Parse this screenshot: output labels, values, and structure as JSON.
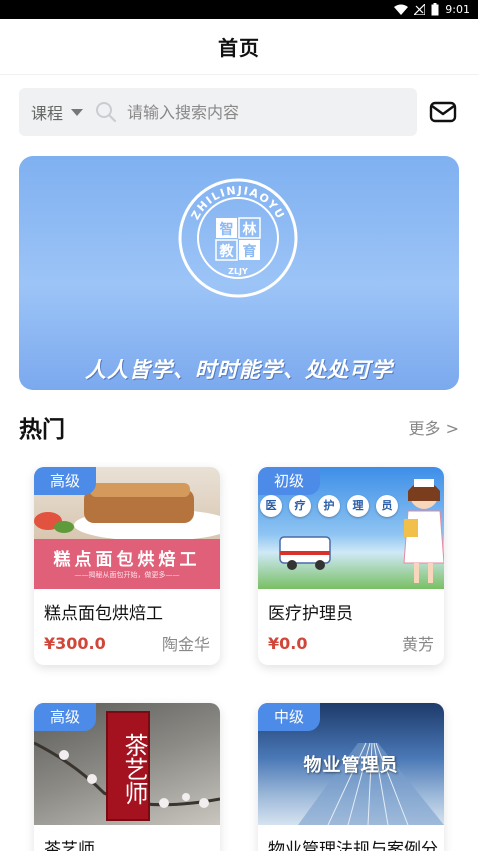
{
  "status_bar": {
    "time": "9:01"
  },
  "header": {
    "title": "首页"
  },
  "search": {
    "category": "课程",
    "placeholder": "请输入搜索内容",
    "value": ""
  },
  "banner": {
    "logo_text": "ZHILINJIAOYU",
    "logo_chars": [
      "智",
      "林",
      "教",
      "育"
    ],
    "logo_abbr": "ZLJY",
    "slogan": "人人皆学、时时能学、处处可学"
  },
  "hot": {
    "title": "热门",
    "more_label": "更多 >"
  },
  "courses": [
    {
      "level": "高级",
      "name": "糕点面包烘焙工",
      "price": "¥300.0",
      "teacher": "陶金华",
      "thumb_title": "糕点面包烘焙工",
      "thumb_sub": "——揭秘从面包开始，做更多——"
    },
    {
      "level": "初级",
      "name": "医疗护理员",
      "price": "¥0.0",
      "teacher": "黄芳",
      "thumb_chips": [
        "医",
        "疗",
        "护",
        "理",
        "员"
      ]
    },
    {
      "level": "高级",
      "name": "茶艺师",
      "thumb_title": "茶艺师"
    },
    {
      "level": "中级",
      "name": "物业管理法规与案例分",
      "thumb_title": "物业管理员"
    }
  ],
  "icons": {
    "search": "search-icon",
    "mail": "mail-icon",
    "caret": "caret-down-icon",
    "wifi": "wifi-icon",
    "signal": "signal-icon",
    "battery": "battery-icon"
  },
  "colors": {
    "accent": "#4c8be8",
    "price": "#d0473a",
    "banner": "#8ebaf4"
  }
}
